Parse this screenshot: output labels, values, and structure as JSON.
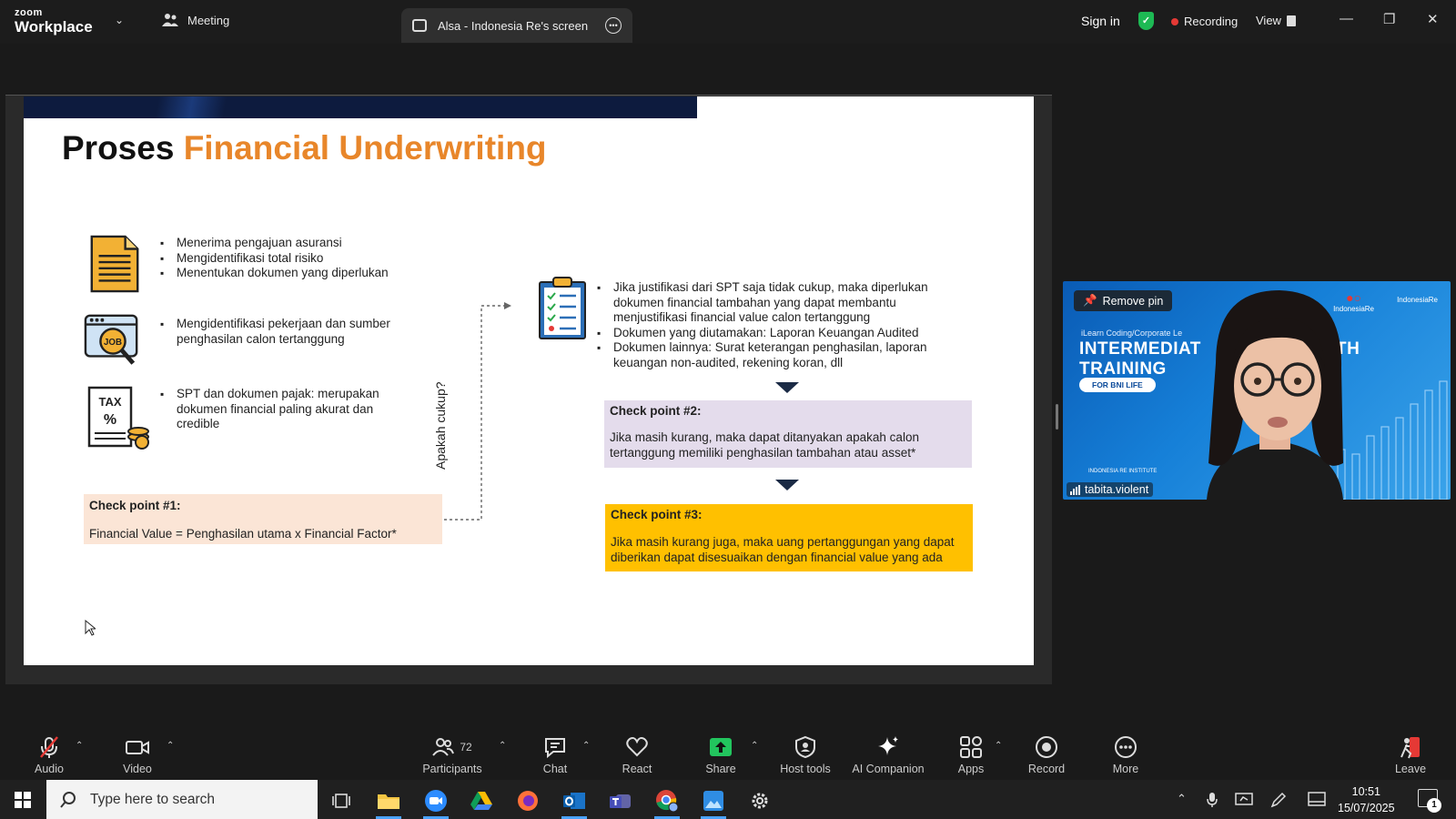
{
  "app": {
    "logo_top": "zoom",
    "logo_bottom": "Workplace",
    "meeting_label": "Meeting",
    "screen_tab_label": "Alsa - Indonesia Re's screen",
    "sign_in": "Sign in",
    "recording": "Recording",
    "view": "View",
    "colors": {
      "recording_dot": "#e53935",
      "shield": "#1db954",
      "accent": "#2d8cff"
    }
  },
  "slide": {
    "title_part1": "Proses",
    "title_part2": "Financial Underwriting",
    "block1": [
      "Menerima pengajuan asuransi",
      "Mengidentifikasi total risiko",
      "Menentukan dokumen yang diperlukan"
    ],
    "block2": [
      "Mengidentifikasi pekerjaan dan sumber penghasilan calon tertanggung"
    ],
    "block3": [
      "SPT dan dokumen pajak: merupakan dokumen financial paling akurat dan credible"
    ],
    "icon2_label": "JOB",
    "icon3_label": "TAX",
    "vertical_label": "Apakah cukup?",
    "checkpoint1": {
      "title": "Check point #1:",
      "body": "Financial Value = Penghasilan utama x Financial Factor*"
    },
    "right_block": [
      "Jika justifikasi dari SPT saja tidak cukup, maka diperlukan dokumen financial tambahan yang dapat membantu menjustifikasi financial value calon tertanggung",
      "Dokumen yang diutamakan: Laporan Keuangan Audited",
      "Dokumen lainnya: Surat keterangan penghasilan, laporan keuangan non-audited, rekening koran, dll"
    ],
    "checkpoint2": {
      "title": "Check point #2:",
      "body": "Jika masih kurang, maka dapat ditanyakan apakah calon tertanggung memiliki penghasilan tambahan atau asset*"
    },
    "checkpoint3": {
      "title": "Check point #3:",
      "body": "Jika masih kurang juga, maka uang pertanggungan yang dapat diberikan dapat disesuaikan dengan financial value yang ada"
    },
    "colors": {
      "title_accent": "#e8862a",
      "cp1_bg": "#fbe5d6",
      "cp2_bg": "#e4dcec",
      "cp3_bg": "#ffc000"
    }
  },
  "video": {
    "remove_pin": "Remove pin",
    "small_text": "iLearn Coding/Corporate Le",
    "line1": "INTERMEDIAT",
    "line1_tail": "TH",
    "line2": "TRAINING",
    "pill": "FOR BNI LIFE",
    "logo1": "IndonesiaRe",
    "logo2": "IndonesiaRe",
    "institute": "INDONESIA RE INSTITUTE",
    "participant_name": "tabita.violent"
  },
  "toolbar": {
    "audio": "Audio",
    "video": "Video",
    "participants": "Participants",
    "participants_count": "72",
    "chat": "Chat",
    "react": "React",
    "share": "Share",
    "host_tools": "Host tools",
    "ai_companion": "AI Companion",
    "apps": "Apps",
    "record": "Record",
    "more": "More",
    "leave": "Leave"
  },
  "taskbar": {
    "search_placeholder": "Type here to search",
    "time": "10:51",
    "date": "15/07/2025",
    "notifications": "1"
  }
}
